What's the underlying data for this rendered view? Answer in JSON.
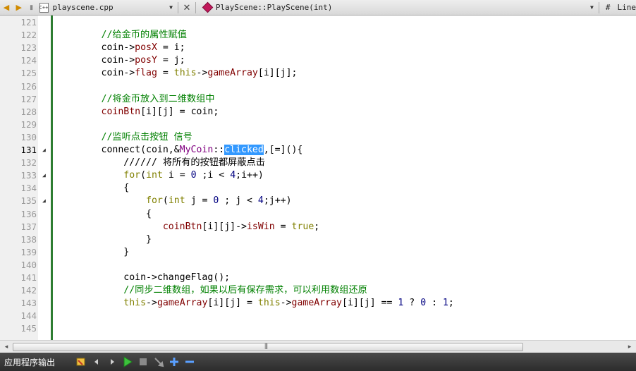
{
  "toolbar": {
    "file_name": "playscene.cpp",
    "symbol_name": "PlayScene::PlayScene(int)",
    "hash_label": "#",
    "line_label": "Line"
  },
  "editor": {
    "current_line": "131",
    "lines": [
      {
        "num": "121",
        "fold": "",
        "segs": []
      },
      {
        "num": "122",
        "fold": "",
        "segs": [
          {
            "t": "        //给金币的属性赋值",
            "c": "c-comment"
          }
        ]
      },
      {
        "num": "123",
        "fold": "",
        "segs": [
          {
            "t": "        coin->",
            "c": ""
          },
          {
            "t": "posX",
            "c": "c-member"
          },
          {
            "t": " = i;",
            "c": ""
          }
        ]
      },
      {
        "num": "124",
        "fold": "",
        "segs": [
          {
            "t": "        coin->",
            "c": ""
          },
          {
            "t": "posY",
            "c": "c-member"
          },
          {
            "t": " = j;",
            "c": ""
          }
        ]
      },
      {
        "num": "125",
        "fold": "",
        "segs": [
          {
            "t": "        coin->",
            "c": ""
          },
          {
            "t": "flag",
            "c": "c-member"
          },
          {
            "t": " = ",
            "c": ""
          },
          {
            "t": "this",
            "c": "c-kw"
          },
          {
            "t": "->",
            "c": ""
          },
          {
            "t": "gameArray",
            "c": "c-member"
          },
          {
            "t": "[i][j];",
            "c": ""
          }
        ]
      },
      {
        "num": "126",
        "fold": "",
        "segs": []
      },
      {
        "num": "127",
        "fold": "",
        "segs": [
          {
            "t": "        //将金币放入到二维数组中",
            "c": "c-comment"
          }
        ]
      },
      {
        "num": "128",
        "fold": "",
        "segs": [
          {
            "t": "        ",
            "c": ""
          },
          {
            "t": "coinBtn",
            "c": "c-member"
          },
          {
            "t": "[i][j] = coin;",
            "c": ""
          }
        ]
      },
      {
        "num": "129",
        "fold": "",
        "segs": []
      },
      {
        "num": "130",
        "fold": "",
        "segs": [
          {
            "t": "        //监听点击按钮 信号",
            "c": "c-comment"
          }
        ]
      },
      {
        "num": "131",
        "fold": "◢",
        "segs": [
          {
            "t": "        connect(coin,&",
            "c": ""
          },
          {
            "t": "MyCoin",
            "c": "c-class"
          },
          {
            "t": "::",
            "c": ""
          },
          {
            "t": "clicked",
            "c": "c-sel"
          },
          {
            "t": ",[=](){",
            "c": ""
          }
        ]
      },
      {
        "num": "132",
        "fold": "",
        "segs": [
          {
            "t": "            ////// 将所有的按钮都屏蔽点击",
            "c": ""
          }
        ]
      },
      {
        "num": "133",
        "fold": "◢",
        "segs": [
          {
            "t": "            ",
            "c": ""
          },
          {
            "t": "for",
            "c": "c-kw"
          },
          {
            "t": "(",
            "c": ""
          },
          {
            "t": "int",
            "c": "c-kw"
          },
          {
            "t": " i = ",
            "c": ""
          },
          {
            "t": "0",
            "c": "c-num"
          },
          {
            "t": " ;i < ",
            "c": ""
          },
          {
            "t": "4",
            "c": "c-num"
          },
          {
            "t": ";i++)",
            "c": ""
          }
        ]
      },
      {
        "num": "134",
        "fold": "",
        "segs": [
          {
            "t": "            {",
            "c": ""
          }
        ]
      },
      {
        "num": "135",
        "fold": "◢",
        "segs": [
          {
            "t": "                ",
            "c": ""
          },
          {
            "t": "for",
            "c": "c-kw"
          },
          {
            "t": "(",
            "c": ""
          },
          {
            "t": "int",
            "c": "c-kw"
          },
          {
            "t": " j = ",
            "c": ""
          },
          {
            "t": "0",
            "c": "c-num"
          },
          {
            "t": " ; j < ",
            "c": ""
          },
          {
            "t": "4",
            "c": "c-num"
          },
          {
            "t": ";j++)",
            "c": ""
          }
        ]
      },
      {
        "num": "136",
        "fold": "",
        "segs": [
          {
            "t": "                {",
            "c": ""
          }
        ]
      },
      {
        "num": "137",
        "fold": "",
        "segs": [
          {
            "t": "                   ",
            "c": ""
          },
          {
            "t": "coinBtn",
            "c": "c-member"
          },
          {
            "t": "[i][j]->",
            "c": ""
          },
          {
            "t": "isWin",
            "c": "c-member"
          },
          {
            "t": " = ",
            "c": ""
          },
          {
            "t": "true",
            "c": "c-kw"
          },
          {
            "t": ";",
            "c": ""
          }
        ]
      },
      {
        "num": "138",
        "fold": "",
        "segs": [
          {
            "t": "                }",
            "c": ""
          }
        ]
      },
      {
        "num": "139",
        "fold": "",
        "segs": [
          {
            "t": "            }",
            "c": ""
          }
        ]
      },
      {
        "num": "140",
        "fold": "",
        "segs": []
      },
      {
        "num": "141",
        "fold": "",
        "segs": [
          {
            "t": "            coin->changeFlag();",
            "c": ""
          }
        ]
      },
      {
        "num": "142",
        "fold": "",
        "segs": [
          {
            "t": "            //同步二维数组，如果以后有保存需求，可以利用数组还原",
            "c": "c-comment"
          }
        ]
      },
      {
        "num": "143",
        "fold": "",
        "segs": [
          {
            "t": "            ",
            "c": ""
          },
          {
            "t": "this",
            "c": "c-kw"
          },
          {
            "t": "->",
            "c": ""
          },
          {
            "t": "gameArray",
            "c": "c-member"
          },
          {
            "t": "[i][j] = ",
            "c": ""
          },
          {
            "t": "this",
            "c": "c-kw"
          },
          {
            "t": "->",
            "c": ""
          },
          {
            "t": "gameArray",
            "c": "c-member"
          },
          {
            "t": "[i][j] == ",
            "c": ""
          },
          {
            "t": "1",
            "c": "c-num"
          },
          {
            "t": " ? ",
            "c": ""
          },
          {
            "t": "0",
            "c": "c-num"
          },
          {
            "t": " : ",
            "c": ""
          },
          {
            "t": "1",
            "c": "c-num"
          },
          {
            "t": ";",
            "c": ""
          }
        ]
      },
      {
        "num": "144",
        "fold": "",
        "segs": []
      },
      {
        "num": "145",
        "fold": "",
        "segs": []
      }
    ]
  },
  "scrollbar": {
    "left_arrow": "◂",
    "right_arrow": "▸",
    "grip": "|||"
  },
  "output_bar": {
    "title": "应用程序输出"
  },
  "icons": {
    "back": "◀",
    "forward": "▶",
    "lock": "🔒",
    "file": "C++",
    "dropdown": "▼",
    "close": "✕"
  }
}
